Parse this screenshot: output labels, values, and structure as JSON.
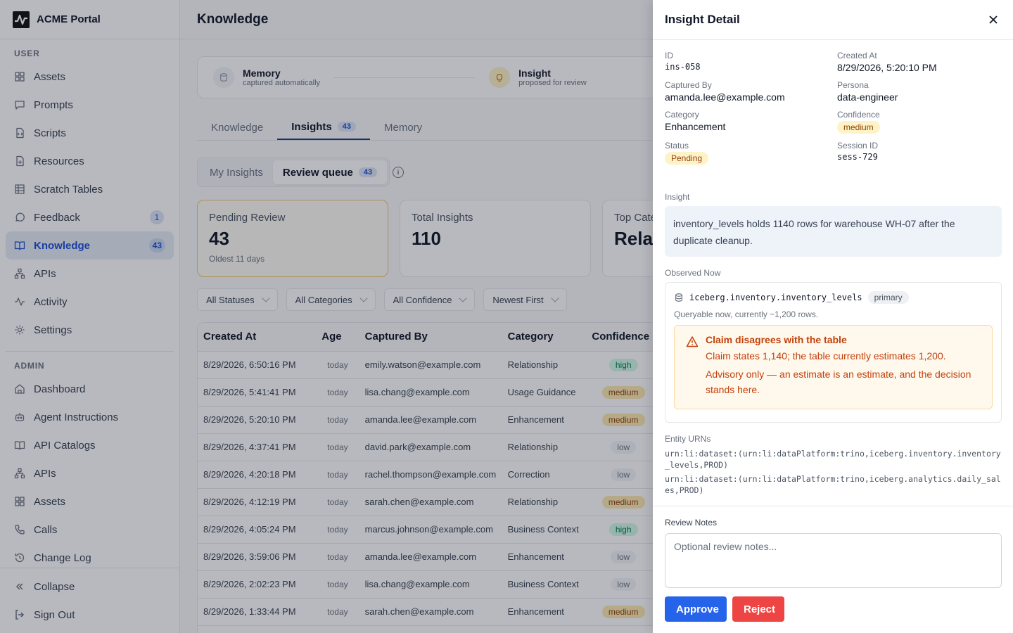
{
  "app": {
    "name": "ACME Portal"
  },
  "sidebar": {
    "user_label": "USER",
    "user_items": [
      {
        "label": "Assets",
        "icon": "grid-icon"
      },
      {
        "label": "Prompts",
        "icon": "message-square-icon"
      },
      {
        "label": "Scripts",
        "icon": "file-code-icon"
      },
      {
        "label": "Resources",
        "icon": "file-plus-icon"
      },
      {
        "label": "Scratch Tables",
        "icon": "table-icon"
      },
      {
        "label": "Feedback",
        "icon": "message-circle-icon",
        "badge": "1"
      },
      {
        "label": "Knowledge",
        "icon": "book-open-icon",
        "badge": "43",
        "active": true
      },
      {
        "label": "APIs",
        "icon": "network-icon"
      },
      {
        "label": "Activity",
        "icon": "activity-icon"
      },
      {
        "label": "Settings",
        "icon": "gear-icon"
      }
    ],
    "admin_label": "ADMIN",
    "admin_items": [
      {
        "label": "Dashboard",
        "icon": "home-icon"
      },
      {
        "label": "Agent Instructions",
        "icon": "bot-icon"
      },
      {
        "label": "API Catalogs",
        "icon": "book-open-icon"
      },
      {
        "label": "APIs",
        "icon": "network-icon"
      },
      {
        "label": "Assets",
        "icon": "grid-icon"
      },
      {
        "label": "Calls",
        "icon": "phone-icon"
      },
      {
        "label": "Change Log",
        "icon": "history-icon"
      }
    ],
    "collapse_label": "Collapse",
    "signout_label": "Sign Out"
  },
  "header": {
    "title": "Knowledge"
  },
  "stepper": [
    {
      "title": "Memory",
      "sub": "captured automatically"
    },
    {
      "title": "Insight",
      "sub": "proposed for review"
    }
  ],
  "tabs": [
    {
      "label": "Knowledge"
    },
    {
      "label": "Insights",
      "badge": "43"
    },
    {
      "label": "Memory"
    }
  ],
  "segment": [
    {
      "label": "My Insights"
    },
    {
      "label": "Review queue",
      "badge": "43"
    }
  ],
  "cards": [
    {
      "label": "Pending Review",
      "value": "43",
      "sub": "Oldest 11 days"
    },
    {
      "label": "Total Insights",
      "value": "110",
      "sub": ""
    },
    {
      "label": "Top Cate",
      "value": "Relat",
      "sub": ""
    }
  ],
  "filters": [
    "All Statuses",
    "All Categories",
    "All Confidence",
    "Newest First"
  ],
  "table": {
    "columns": [
      "Created At",
      "Age",
      "Captured By",
      "Category",
      "Confidence"
    ],
    "rows": [
      [
        "8/29/2026, 6:50:16 PM",
        "today",
        "emily.watson@example.com",
        "Relationship",
        "high"
      ],
      [
        "8/29/2026, 5:41:41 PM",
        "today",
        "lisa.chang@example.com",
        "Usage Guidance",
        "medium"
      ],
      [
        "8/29/2026, 5:20:10 PM",
        "today",
        "amanda.lee@example.com",
        "Enhancement",
        "medium"
      ],
      [
        "8/29/2026, 4:37:41 PM",
        "today",
        "david.park@example.com",
        "Relationship",
        "low"
      ],
      [
        "8/29/2026, 4:20:18 PM",
        "today",
        "rachel.thompson@example.com",
        "Correction",
        "low"
      ],
      [
        "8/29/2026, 4:12:19 PM",
        "today",
        "sarah.chen@example.com",
        "Relationship",
        "medium"
      ],
      [
        "8/29/2026, 4:05:24 PM",
        "today",
        "marcus.johnson@example.com",
        "Business Context",
        "high"
      ],
      [
        "8/29/2026, 3:59:06 PM",
        "today",
        "amanda.lee@example.com",
        "Enhancement",
        "low"
      ],
      [
        "8/29/2026, 2:02:23 PM",
        "today",
        "lisa.chang@example.com",
        "Business Context",
        "low"
      ],
      [
        "8/29/2026, 1:33:44 PM",
        "today",
        "sarah.chen@example.com",
        "Enhancement",
        "medium"
      ],
      [
        "",
        "",
        "",
        "",
        ""
      ]
    ]
  },
  "drawer": {
    "title": "Insight Detail",
    "fields": {
      "id_label": "ID",
      "id": "ins-058",
      "created_label": "Created At",
      "created": "8/29/2026, 5:20:10 PM",
      "captured_label": "Captured By",
      "captured": "amanda.lee@example.com",
      "persona_label": "Persona",
      "persona": "data-engineer",
      "category_label": "Category",
      "category": "Enhancement",
      "confidence_label": "Confidence",
      "confidence": "medium",
      "status_label": "Status",
      "status": "Pending",
      "session_label": "Session ID",
      "session": "sess-729"
    },
    "insight_label": "Insight",
    "insight_text": "inventory_levels holds 1140 rows for warehouse WH-07 after the duplicate cleanup.",
    "observed_label": "Observed Now",
    "observed_table": "iceberg.inventory.inventory_levels",
    "observed_tag": "primary",
    "observed_sub": "Queryable now, currently ~1,200 rows.",
    "warning_title": "Claim disagrees with the table",
    "warning_text1": "Claim states 1,140; the table currently estimates 1,200.",
    "warning_text2": "Advisory only — an estimate is an estimate, and the decision stands here.",
    "urns_label": "Entity URNs",
    "urns": [
      "urn:li:dataset:(urn:li:dataPlatform:trino,iceberg.inventory.inventory_levels,PROD)",
      "urn:li:dataset:(urn:li:dataPlatform:trino,iceberg.analytics.daily_sales,PROD)"
    ],
    "notes_label": "Review Notes",
    "notes_placeholder": "Optional review notes...",
    "approve_label": "Approve",
    "reject_label": "Reject"
  }
}
